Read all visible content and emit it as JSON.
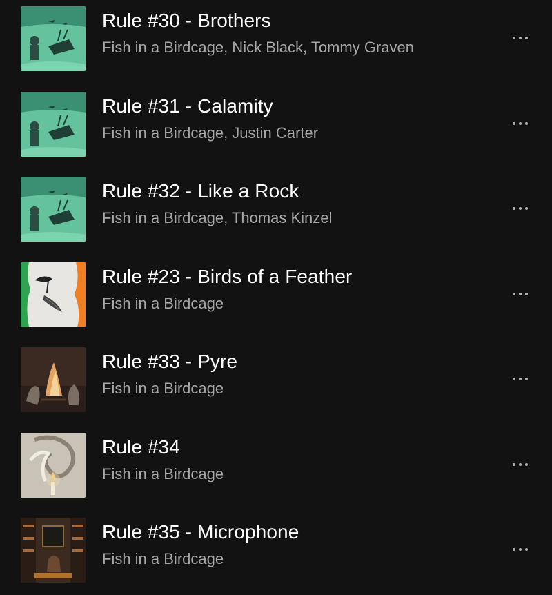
{
  "tracks": [
    {
      "title": "Rule #30 - Brothers",
      "artists": "Fish in a Birdcage, Nick Black, Tommy Graven",
      "cover_icon": "underwater-shipwreck-cover"
    },
    {
      "title": "Rule #31 - Calamity",
      "artists": "Fish in a Birdcage, Justin Carter",
      "cover_icon": "underwater-shipwreck-cover"
    },
    {
      "title": "Rule #32 - Like a Rock",
      "artists": "Fish in a Birdcage, Thomas Kinzel",
      "cover_icon": "underwater-shipwreck-cover"
    },
    {
      "title": "Rule #23 - Birds of a Feather",
      "artists": "Fish in a Birdcage",
      "cover_icon": "bird-and-fish-tricolor-cover"
    },
    {
      "title": "Rule #33 - Pyre",
      "artists": "Fish in a Birdcage",
      "cover_icon": "bonfire-cover"
    },
    {
      "title": "Rule #34",
      "artists": "Fish in a Birdcage",
      "cover_icon": "candle-smoke-cover"
    },
    {
      "title": "Rule #35 - Microphone",
      "artists": "Fish in a Birdcage",
      "cover_icon": "library-room-cover"
    }
  ],
  "more_icon": "more-options-icon",
  "colors": {
    "background": "#121212",
    "title": "#ffffff",
    "subtitle": "#a7a7a7",
    "dots": "#b3b3b3"
  }
}
